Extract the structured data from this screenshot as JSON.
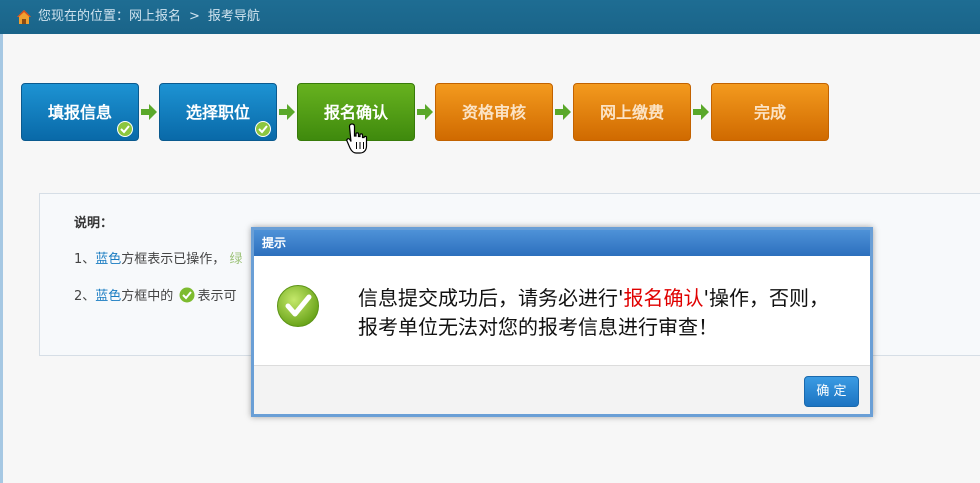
{
  "breadcrumb": {
    "prefix": "您现在的位置：网上报名",
    "separator": ">",
    "current": "报考导航"
  },
  "steps": [
    {
      "label": "填报信息",
      "state": "done",
      "color": "#0f7fc0"
    },
    {
      "label": "选择职位",
      "state": "done",
      "color": "#0f7fc0"
    },
    {
      "label": "报名确认",
      "state": "current",
      "color": "#4f9a15"
    },
    {
      "label": "资格审核",
      "state": "pending",
      "color": "#e07d08"
    },
    {
      "label": "网上缴费",
      "state": "pending",
      "color": "#e07d08"
    },
    {
      "label": "完成",
      "state": "pending",
      "color": "#e07d08"
    }
  ],
  "notice": {
    "title": "说明：",
    "line1_prefix": "1、",
    "line1_blue": "蓝色",
    "line1_text": "方框表示已操作，",
    "line1_faded": "绿",
    "line2_prefix": "2、",
    "line2_blue": "蓝色",
    "line2_text": "方框中的",
    "line2_tail": "表示可"
  },
  "dialog": {
    "title": "提示",
    "message_part1": "信息提交成功后，请务必进行'",
    "message_highlight": "报名确认",
    "message_part2": "'操作，否则，报考单位无法对您的报考信息进行审查！",
    "ok_label": "确 定"
  }
}
